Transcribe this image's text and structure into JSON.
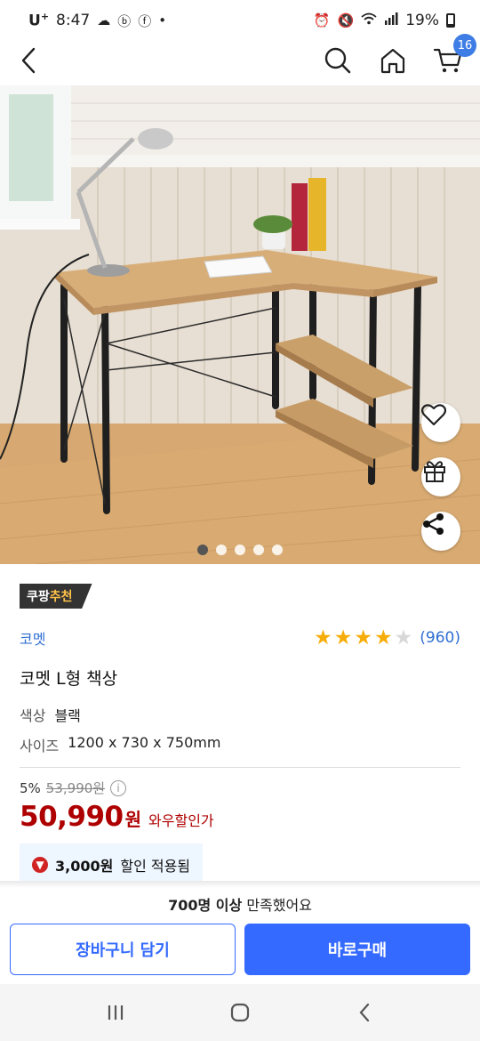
{
  "status_bar": {
    "carrier": "U",
    "carrier_sup": "+",
    "time": "8:47",
    "battery": "19%"
  },
  "nav": {
    "cart_count": "16"
  },
  "gallery": {
    "image_count": 5,
    "active_index": 0
  },
  "product": {
    "badge_prefix": "쿠팡",
    "badge_highlight": "추천",
    "brand": "코멧",
    "rating": 4.5,
    "review_count": "(960)",
    "title": "코멧 L형 책상",
    "options": [
      {
        "label": "색상",
        "value": "블랙"
      },
      {
        "label": "사이즈",
        "value": "1200 x 730 x 750mm"
      }
    ],
    "discount_rate": "5%",
    "original_price": "53,990원",
    "price": "50,990",
    "price_unit": "원",
    "price_tag": "와우할인가",
    "coupon_amount": "3,000원",
    "coupon_text": "할인 적용됨"
  },
  "purchase": {
    "satisfied_bold": "700명 이상",
    "satisfied_rest": "만족했어요",
    "cart_button": "장바구니 담기",
    "buy_button": "바로구매"
  },
  "colors": {
    "accent_blue": "#346aff",
    "price_red": "#ae0000",
    "link_blue": "#2f6fd1",
    "star": "#f7ad09"
  }
}
